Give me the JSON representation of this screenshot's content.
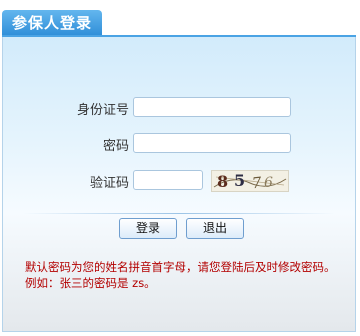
{
  "panel": {
    "tab_title": "参保人登录"
  },
  "form": {
    "id_label": "身份证号",
    "id_value": "",
    "password_label": "密码",
    "password_value": "",
    "captcha_label": "验证码",
    "captcha_value": "",
    "captcha_text": "8576"
  },
  "buttons": {
    "login": "登录",
    "exit": "退出"
  },
  "notice": {
    "line1": "默认密码为您的姓名拼音首字母，请您登陆后及时修改密码。",
    "line2": "例如：张三的密码是 zs。"
  }
}
